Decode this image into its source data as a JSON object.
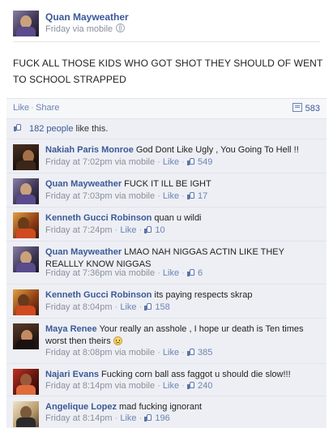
{
  "post": {
    "author": "Quan Mayweather",
    "meta": "Friday via mobile",
    "text": "FUCK ALL THOSE KIDS WHO GOT SHOT THEY SHOULD OF WENT TO SCHOOL STRAPPED",
    "like_label": "Like",
    "share_label": "Share",
    "comment_count": "583",
    "likes_count": "182 people",
    "likes_suffix": " like this."
  },
  "comments": [
    {
      "name": "Nakiah Paris Monroe",
      "text": "God Dont Like Ugly , You Going To Hell !!",
      "time": "Friday at 7:02pm via mobile",
      "like_label": "Like",
      "likes": "549"
    },
    {
      "name": "Quan Mayweather",
      "text": "FUCK IT ILL BE IGHT",
      "time": "Friday at 7:03pm via mobile",
      "like_label": "Like",
      "likes": "17"
    },
    {
      "name": "Kenneth Gucci Robinson",
      "text": "quan u wildi",
      "time": "Friday at 7:24pm",
      "like_label": "Like",
      "likes": "10"
    },
    {
      "name": "Quan Mayweather",
      "text": "LMAO NAH NIGGAS ACTIN LIKE THEY REALLLY KNOW NIGGAS",
      "time": "Friday at 7:36pm via mobile",
      "like_label": "Like",
      "likes": "6"
    },
    {
      "name": "Kenneth Gucci Robinson",
      "text": "its paying respects skrap",
      "time": "Friday at 8:04pm",
      "like_label": "Like",
      "likes": "158"
    },
    {
      "name": "Maya Renee",
      "text": "Your really an asshole , I hope ur death is Ten times worst then theirs",
      "time": "Friday at 8:08pm via mobile",
      "like_label": "Like",
      "likes": "385"
    },
    {
      "name": "Najari Evans",
      "text": "Fucking corn ball ass faggot u should die slow!!!",
      "time": "Friday at 8:14pm via mobile",
      "like_label": "Like",
      "likes": "240"
    },
    {
      "name": "Angelique Lopez",
      "text": "mad fucking ignorant",
      "time": "Friday at 8:14pm",
      "like_label": "Like",
      "likes": "196"
    }
  ],
  "icons": {
    "privacy": "globe-icon",
    "comment": "comment-icon",
    "like": "thumbs-up-icon",
    "emoticon": "frown-icon"
  },
  "colors": {
    "link": "#3b5998",
    "comment_bg": "#edeff4",
    "meta": "#898f9c"
  }
}
